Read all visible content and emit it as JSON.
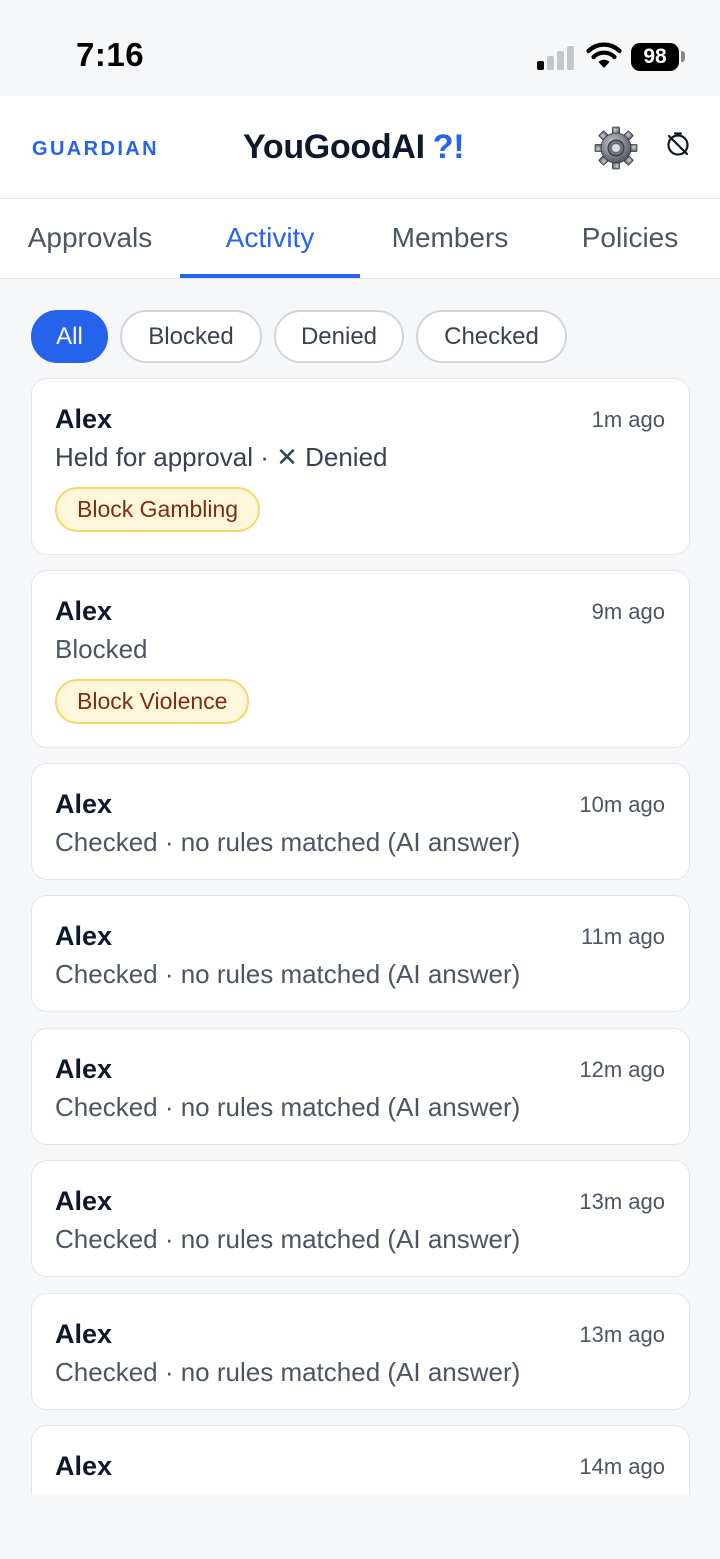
{
  "status_bar": {
    "time": "7:16",
    "battery": "98"
  },
  "header": {
    "brand": "GUARDIAN",
    "title": "YouGoodAI",
    "title_accent": "?!",
    "settings_icon": "gear-icon",
    "timer_icon": "timer-off-icon"
  },
  "tabs": [
    {
      "label": "Approvals",
      "active": false
    },
    {
      "label": "Activity",
      "active": true
    },
    {
      "label": "Members",
      "active": false
    },
    {
      "label": "Policies",
      "active": false
    }
  ],
  "filters": [
    {
      "label": "All",
      "active": true
    },
    {
      "label": "Blocked",
      "active": false
    },
    {
      "label": "Denied",
      "active": false
    },
    {
      "label": "Checked",
      "active": false
    }
  ],
  "activity": [
    {
      "name": "Alex",
      "time": "1m ago",
      "detail": "Held for approval · ✕ Denied",
      "tag": "Block Gambling"
    },
    {
      "name": "Alex",
      "time": "9m ago",
      "detail": "Blocked",
      "tag": "Block Violence"
    },
    {
      "name": "Alex",
      "time": "10m ago",
      "detail": "Checked · no rules matched (AI answer)"
    },
    {
      "name": "Alex",
      "time": "11m ago",
      "detail": "Checked · no rules matched (AI answer)"
    },
    {
      "name": "Alex",
      "time": "12m ago",
      "detail": "Checked · no rules matched (AI answer)"
    },
    {
      "name": "Alex",
      "time": "13m ago",
      "detail": "Checked · no rules matched (AI answer)"
    },
    {
      "name": "Alex",
      "time": "13m ago",
      "detail": "Checked · no rules matched (AI answer)"
    },
    {
      "name": "Alex",
      "time": "14m ago",
      "detail": ""
    }
  ],
  "colors": {
    "accent": "#2563eb",
    "tag_bg": "#fef7dc",
    "tag_border": "#fcd46a",
    "tag_text": "#7c2d12"
  }
}
